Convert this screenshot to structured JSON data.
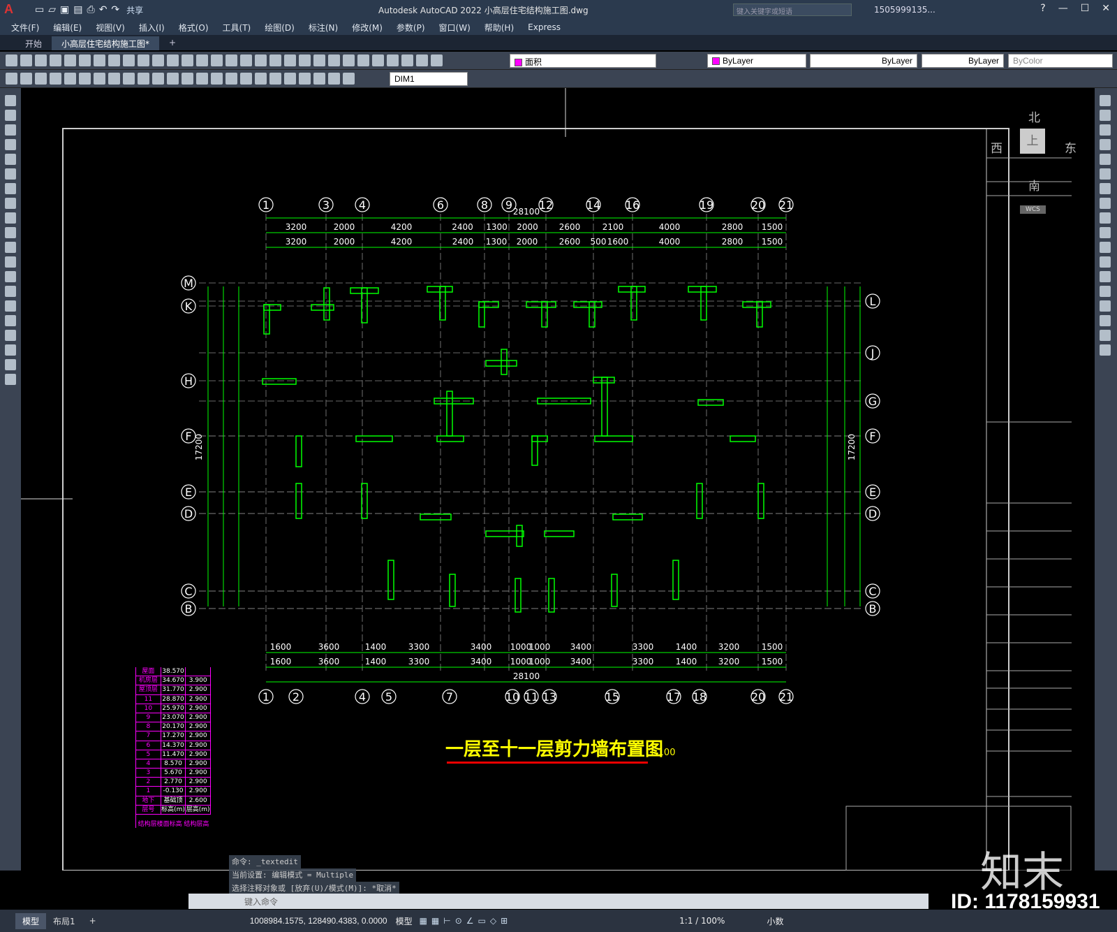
{
  "app": {
    "title": "Autodesk AutoCAD 2022    小高层住宅结构施工图.dwg",
    "logo": "A",
    "share_label": "共享",
    "search_placeholder": "键入关键字或短语",
    "user": "1505999135...",
    "help": "?"
  },
  "menu": [
    "文件(F)",
    "编辑(E)",
    "视图(V)",
    "插入(I)",
    "格式(O)",
    "工具(T)",
    "绘图(D)",
    "标注(N)",
    "修改(M)",
    "参数(P)",
    "窗口(W)",
    "帮助(H)",
    "Express"
  ],
  "tabs": [
    {
      "label": "开始"
    },
    {
      "label": "小高层住宅结构施工图*"
    }
  ],
  "toolbar": {
    "layer_name": "面积",
    "color": "ByLayer",
    "linetype": "ByLayer",
    "lineweight": "ByLayer",
    "plotstyle": "ByColor",
    "dimstyle": "DIM1"
  },
  "drawing": {
    "title": "一层至十一层剪力墙布置图",
    "scale": "1:100",
    "overall_dim": "28100",
    "top_axes": [
      "1",
      "3",
      "4",
      "6",
      "8",
      "9",
      "12",
      "14",
      "16",
      "19",
      "20",
      "21"
    ],
    "bottom_axes": [
      "1",
      "2",
      "4",
      "5",
      "7",
      "10",
      "11",
      "13",
      "15",
      "17",
      "18",
      "20",
      "21"
    ],
    "left_axes": [
      "M",
      "K",
      "H",
      "F",
      "E",
      "D",
      "C",
      "B"
    ],
    "right_axes": [
      "L",
      "J",
      "G",
      "F",
      "E",
      "D",
      "C",
      "B"
    ],
    "top_dims": [
      "3200",
      "2000",
      "4200",
      "2400",
      "1300",
      "2000",
      "2600",
      "2100",
      "4000",
      "2800",
      "1500"
    ],
    "top_dims2": [
      "3200",
      "2000",
      "4200",
      "2400",
      "1300",
      "2000",
      "2600",
      "500",
      "1600",
      "4000",
      "2800",
      "1500"
    ],
    "bottom_dims": [
      "1600",
      "3600",
      "1400",
      "3300",
      "3400",
      "1000",
      "1000",
      "3400",
      "3300",
      "1400",
      "3200",
      "1500"
    ],
    "left_vdim": "17200",
    "right_vdim": "17200",
    "compass": {
      "n": "北",
      "s": "南",
      "w": "西",
      "e": "东",
      "c": "上",
      "wcs": "WCS"
    }
  },
  "elevation_table": {
    "header": [
      "屋面",
      "38.570",
      ""
    ],
    "rows": [
      [
        "机房层",
        "34.670",
        "3.900"
      ],
      [
        "屋顶层",
        "31.770",
        "2.900"
      ],
      [
        "11",
        "28.870",
        "2.900"
      ],
      [
        "10",
        "25.970",
        "2.900"
      ],
      [
        "9",
        "23.070",
        "2.900"
      ],
      [
        "8",
        "20.170",
        "2.900"
      ],
      [
        "7",
        "17.270",
        "2.900"
      ],
      [
        "6",
        "14.370",
        "2.900"
      ],
      [
        "5",
        "11.470",
        "2.900"
      ],
      [
        "4",
        "8.570",
        "2.900"
      ],
      [
        "3",
        "5.670",
        "2.900"
      ],
      [
        "2",
        "2.770",
        "2.900"
      ],
      [
        "1",
        "-0.130",
        "2.900"
      ],
      [
        "地下",
        "基础顶",
        "2.600"
      ],
      [
        "层号",
        "标高(m)",
        "层高(m)"
      ]
    ],
    "caption": "结构层楼面标高 结构层高"
  },
  "command": {
    "history": [
      "命令: _textedit",
      "当前设置: 编辑模式 = Multiple",
      "选择注释对象或 [放弃(U)/模式(M)]: *取消*"
    ],
    "prompt": "键入命令"
  },
  "status": {
    "tabs": [
      "模型",
      "布局1"
    ],
    "coords": "1008984.1575, 128490.4383, 0.0000",
    "mode": "模型",
    "scale": "1:1 / 100%",
    "units": "小数"
  },
  "watermark": {
    "brand": "知末",
    "id": "ID: 1178159931"
  }
}
